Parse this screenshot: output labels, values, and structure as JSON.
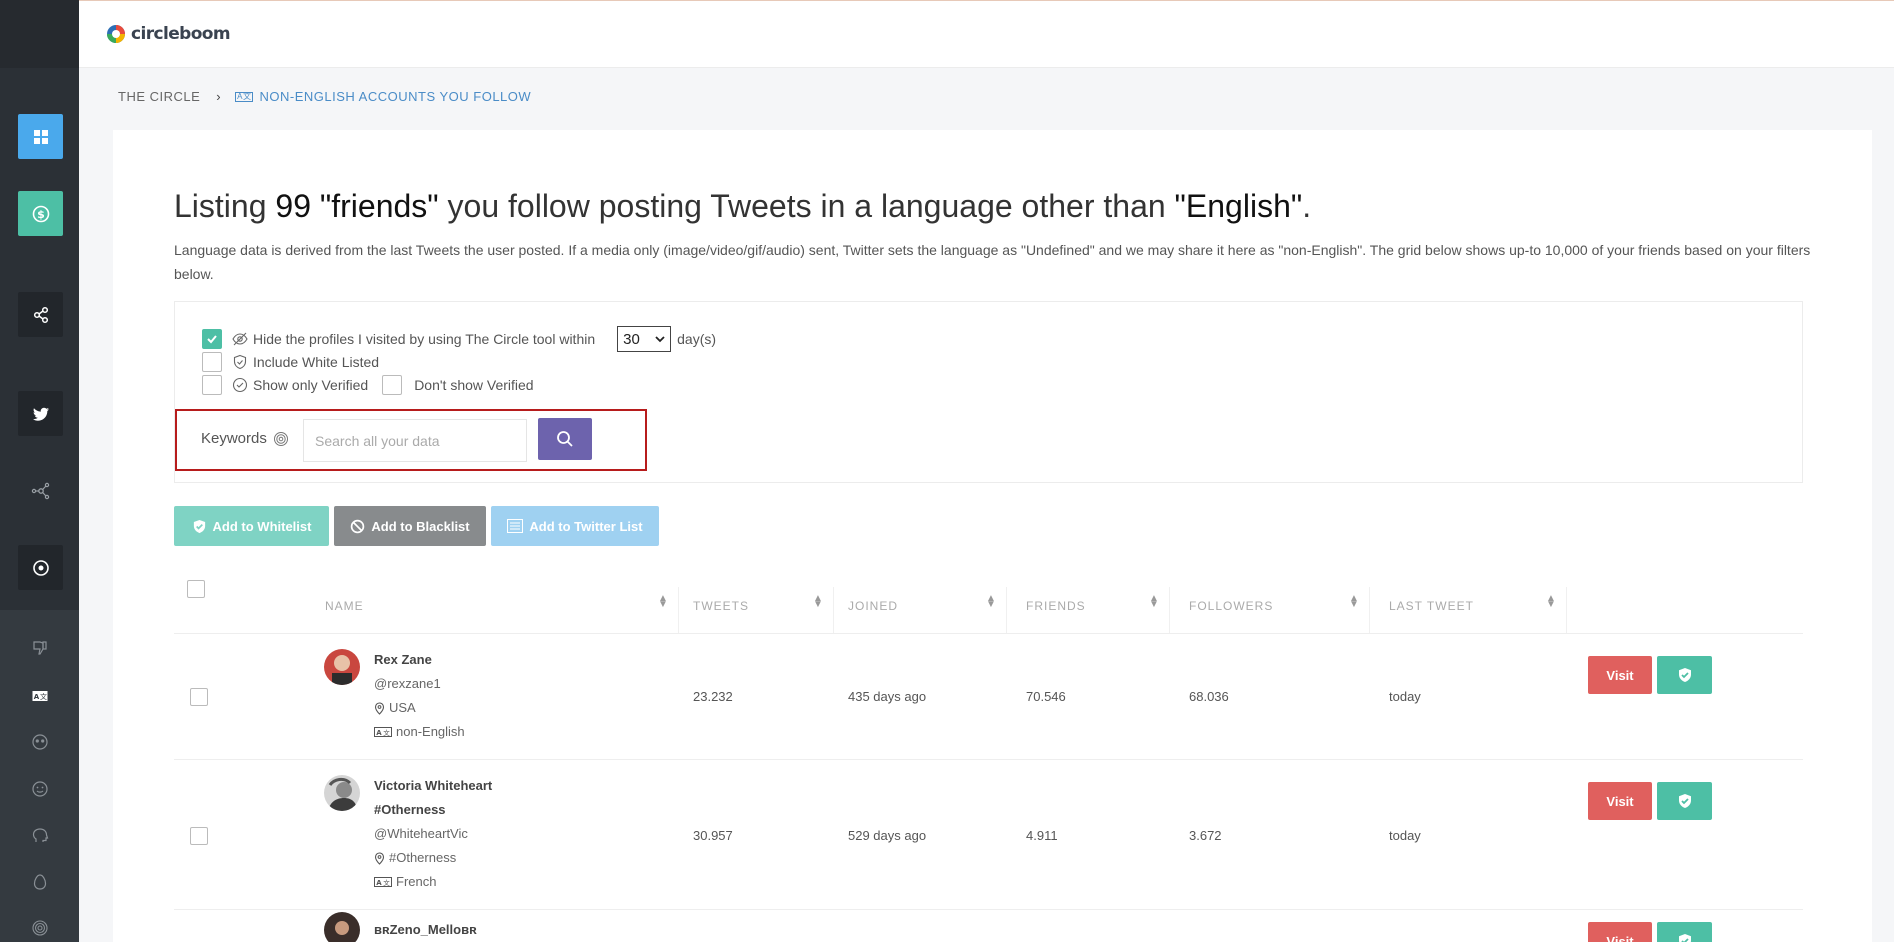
{
  "app": {
    "logo_text": "circleboom"
  },
  "breadcrumb": {
    "root": "THE CIRCLE",
    "current": "NON-ENGLISH ACCOUNTS YOU FOLLOW"
  },
  "headline": {
    "part1": "Listing ",
    "count": "99",
    "part2": " \"friends\"",
    "part3": " you follow posting Tweets in a language other than ",
    "lang": "\"English\"",
    "part4": "."
  },
  "description": "Language data is derived from the last Tweets the user posted. If a media only (image/video/gif/audio) sent, Twitter sets the language as \"Undefined\" and we may share it here as \"non-English\". The grid below shows up-to 10,000 of your friends based on your filters below.",
  "filters": {
    "hide_visited_label": "Hide the profiles I visited by using The Circle tool within",
    "hide_visited_checked": true,
    "days_value": "30",
    "days_label": "day(s)",
    "include_whitelisted_label": "Include White Listed",
    "show_verified_label": "Show only Verified",
    "dont_show_verified_label": "Don't show Verified",
    "keywords_label": "Keywords",
    "search_placeholder": "Search all your data"
  },
  "actions": {
    "whitelist": "Add to Whitelist",
    "blacklist": "Add to Blacklist",
    "twitter_list": "Add to Twitter List"
  },
  "table": {
    "columns": [
      "NAME",
      "TWEETS",
      "JOINED",
      "FRIENDS",
      "FOLLOWERS",
      "LAST TWEET"
    ],
    "visit_label": "Visit",
    "rows": [
      {
        "name": "Rex Zane",
        "name2": "",
        "handle": "@rexzane1",
        "location": "USA",
        "language": "non-English",
        "tweets": "23.232",
        "joined": "435 days ago",
        "friends": "70.546",
        "followers": "68.036",
        "last_tweet": "today"
      },
      {
        "name": "Victoria Whiteheart",
        "name2": "#Otherness",
        "handle": "@WhiteheartVic",
        "location": "#Otherness",
        "language": "French",
        "tweets": "30.957",
        "joined": "529 days ago",
        "friends": "4.911",
        "followers": "3.672",
        "last_tweet": "today"
      },
      {
        "name": "ʙʀZeno_Melloʙʀ"
      }
    ]
  }
}
